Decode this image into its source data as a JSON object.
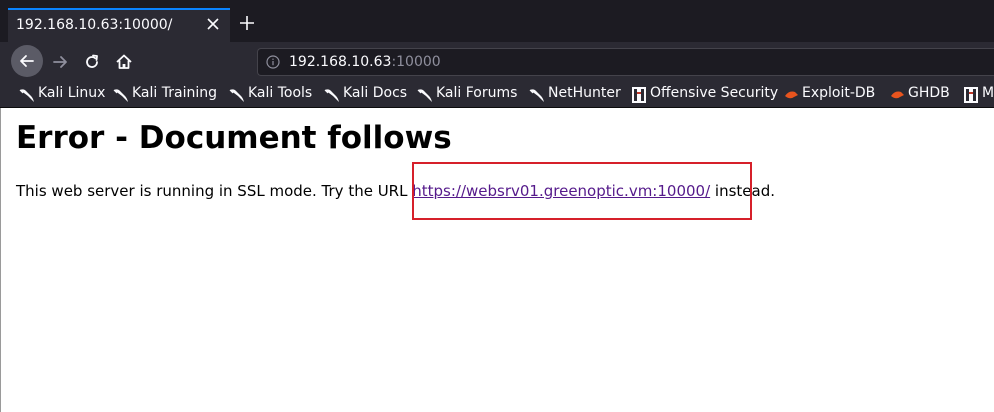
{
  "tab": {
    "title": "192.168.10.63:10000/"
  },
  "url": {
    "host": "192.168.10.63",
    "port": ":10000"
  },
  "icons": {
    "close": "close-icon",
    "newtab": "plus-icon",
    "back": "arrow-left-icon",
    "forward": "arrow-right-icon",
    "reload": "reload-icon",
    "home": "home-icon",
    "info": "info-icon",
    "kali": "kali-dragon-icon",
    "offsec": "offensive-security-icon",
    "exploitdb": "exploit-db-icon",
    "ghdb": "ghdb-icon"
  },
  "bookmarks": [
    "Kali Linux",
    "Kali Training",
    "Kali Tools",
    "Kali Docs",
    "Kali Forums",
    "NetHunter",
    "Offensive Security",
    "Exploit-DB",
    "GHDB",
    "M"
  ],
  "page": {
    "heading": "Error - Document follows",
    "text_before": "This web server is running in SSL mode. Try the URL ",
    "link": "https://websrv01.greenoptic.vm:10000/",
    "text_after": " instead."
  },
  "colors": {
    "toolbar": "#2b2a33",
    "tabstrip": "#1c1b22",
    "accent": "#0a84ff",
    "link": "#551a8b",
    "highlight": "#d6202a"
  }
}
